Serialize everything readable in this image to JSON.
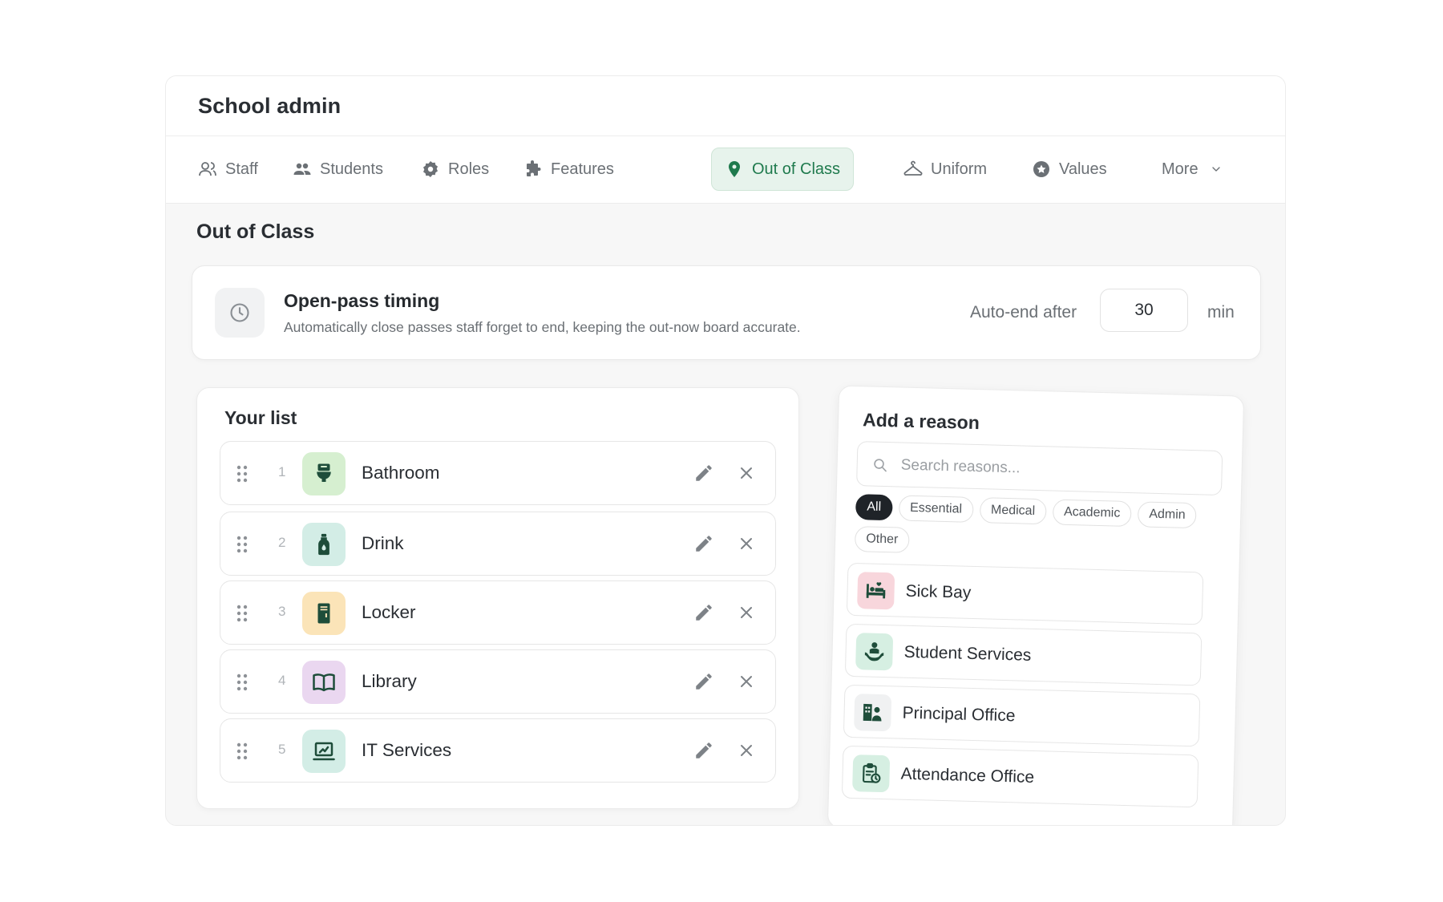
{
  "header": {
    "title": "School admin"
  },
  "tabs": [
    {
      "label": "Staff",
      "icon": "users-outline-icon"
    },
    {
      "label": "Students",
      "icon": "users-icon"
    },
    {
      "label": "Roles",
      "icon": "badge-icon"
    },
    {
      "label": "Features",
      "icon": "puzzle-icon"
    },
    {
      "label": "Out of Class",
      "icon": "map-pin-icon",
      "active": true
    },
    {
      "label": "Uniform",
      "icon": "hanger-icon"
    },
    {
      "label": "Values",
      "icon": "star-circle-icon"
    },
    {
      "label": "More",
      "icon": "chevron-down-icon"
    }
  ],
  "section": {
    "title": "Out of Class"
  },
  "timing": {
    "title": "Open-pass timing",
    "description": "Automatically close passes staff forget to end, keeping the out-now board accurate.",
    "auto_label": "Auto-end after",
    "value": "30",
    "unit": "min"
  },
  "list": {
    "title": "Your list",
    "items": [
      {
        "index": "1",
        "label": "Bathroom",
        "icon": "toilet-icon",
        "color": "#d6efd0"
      },
      {
        "index": "2",
        "label": "Drink",
        "icon": "bottle-icon",
        "color": "#d3ede6"
      },
      {
        "index": "3",
        "label": "Locker",
        "icon": "locker-icon",
        "color": "#fbe4b8"
      },
      {
        "index": "4",
        "label": "Library",
        "icon": "book-icon",
        "color": "#ead7f0"
      },
      {
        "index": "5",
        "label": "IT Services",
        "icon": "laptop-icon",
        "color": "#d3ede6"
      }
    ]
  },
  "add_reason": {
    "title": "Add a reason",
    "search_placeholder": "Search reasons...",
    "chips": [
      {
        "label": "All",
        "active": true
      },
      {
        "label": "Essential"
      },
      {
        "label": "Medical"
      },
      {
        "label": "Academic"
      },
      {
        "label": "Admin"
      },
      {
        "label": "Other"
      }
    ],
    "items": [
      {
        "label": "Sick Bay",
        "icon": "bed-icon",
        "color": "#f8d6dc"
      },
      {
        "label": "Student Services",
        "icon": "hand-heart-icon",
        "color": "#d6efe2"
      },
      {
        "label": "Principal Office",
        "icon": "office-person-icon",
        "color": "#f0f1f2"
      },
      {
        "label": "Attendance Office",
        "icon": "clipboard-clock-icon",
        "color": "#d6efe2"
      }
    ]
  },
  "colors": {
    "accent": "#1f7a4d",
    "accent_bg": "#e7f3ec",
    "icon_dark": "#1e4d3a"
  }
}
